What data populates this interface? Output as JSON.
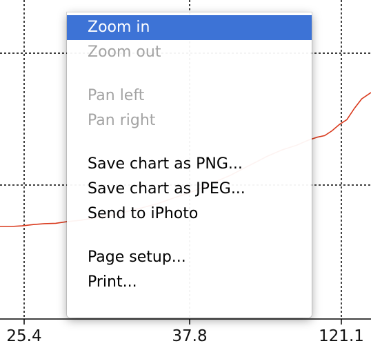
{
  "chart_data": {
    "type": "line",
    "x_tick_labels": [
      "25.4",
      "37.8",
      "121.1"
    ],
    "grid": true,
    "series_color": "#d9391c",
    "series": [
      {
        "x": [
          0.0,
          0.03,
          0.06,
          0.09,
          0.12,
          0.15,
          0.18,
          0.22,
          0.27,
          0.32,
          0.37,
          0.42,
          0.47,
          0.52,
          0.57,
          0.62,
          0.67,
          0.72,
          0.76,
          0.8,
          0.83,
          0.855,
          0.875,
          0.895,
          0.915,
          0.935,
          0.955,
          0.975,
          1.0
        ],
        "y": [
          0.29,
          0.29,
          0.292,
          0.296,
          0.299,
          0.3,
          0.305,
          0.31,
          0.32,
          0.33,
          0.345,
          0.36,
          0.38,
          0.4,
          0.425,
          0.45,
          0.48,
          0.51,
          0.53,
          0.545,
          0.56,
          0.57,
          0.575,
          0.59,
          0.61,
          0.625,
          0.66,
          0.69,
          0.71
        ]
      }
    ]
  },
  "menu": {
    "items": [
      {
        "label": "Zoom in",
        "state": "highlighted"
      },
      {
        "label": "Zoom out",
        "state": "disabled"
      },
      {
        "separator": true
      },
      {
        "label": "Pan left",
        "state": "disabled"
      },
      {
        "label": "Pan right",
        "state": "disabled"
      },
      {
        "separator": true
      },
      {
        "label": "Save chart as PNG...",
        "state": "enabled"
      },
      {
        "label": "Save chart as JPEG...",
        "state": "enabled"
      },
      {
        "label": "Send to iPhoto",
        "state": "enabled"
      },
      {
        "separator": true
      },
      {
        "label": "Page setup...",
        "state": "enabled"
      },
      {
        "label": "Print...",
        "state": "enabled"
      }
    ],
    "highlight_color": "#3d73d6"
  }
}
